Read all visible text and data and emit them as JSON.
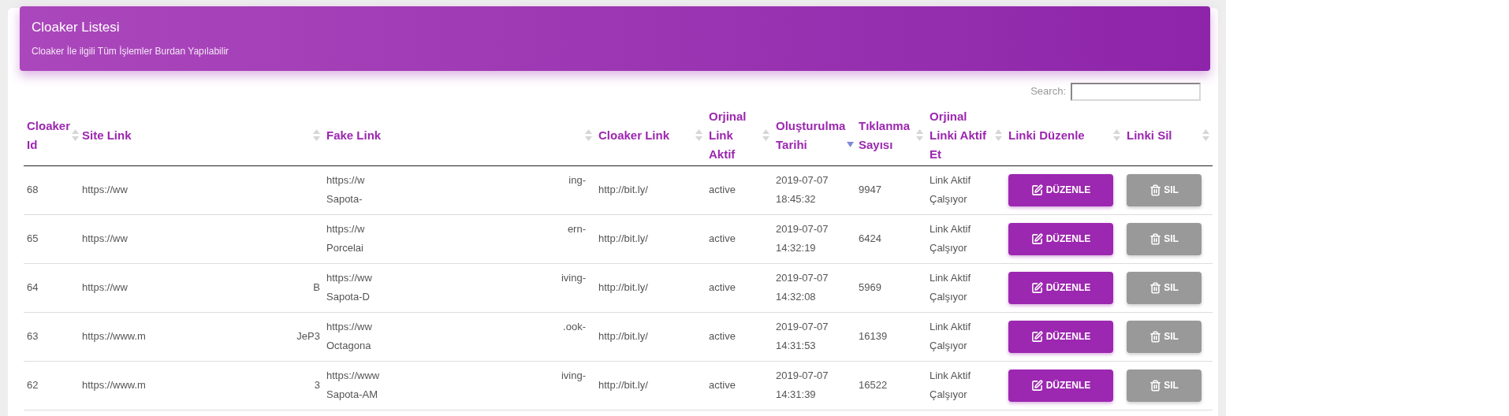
{
  "header": {
    "title": "Cloaker Listesi",
    "subtitle": "Cloaker İle ilgili Tüm İşlemler Burdan Yapılabilir"
  },
  "search": {
    "label": "Search:"
  },
  "columns": [
    {
      "label": "Cloaker Id",
      "sorted": false
    },
    {
      "label": "Site Link",
      "sorted": false
    },
    {
      "label": "Fake Link",
      "sorted": false
    },
    {
      "label": "Cloaker Link",
      "sorted": false
    },
    {
      "label": "Orjinal Link Aktif",
      "sorted": false
    },
    {
      "label": "Oluşturulma Tarihi",
      "sorted": true
    },
    {
      "label": "Tıklanma Sayısı",
      "sorted": false
    },
    {
      "label": "Orjinal Linki Aktif Et",
      "sorted": false
    },
    {
      "label": "Linki Düzenle",
      "sorted": false
    },
    {
      "label": "Linki Sil",
      "sorted": false
    }
  ],
  "rows": [
    {
      "id": "68",
      "site_link": "https://ww",
      "fake_link_start": "https://w",
      "fake_link_end": "ing-",
      "fake_link_line2": "Sapota-",
      "cloaker_link": "http://bit.ly/",
      "status": "active",
      "date": "2019-07-07",
      "time": "18:45:32",
      "clicks": "9947",
      "link_state": "Link Aktif Çalşıyor",
      "edit": "DÜZENLE",
      "delete": "SIL"
    },
    {
      "id": "65",
      "site_link": "https://ww",
      "fake_link_start": "https://w",
      "fake_link_end": "ern-",
      "fake_link_line2": "Porcelai",
      "cloaker_link": "http://bit.ly/",
      "status": "active",
      "date": "2019-07-07",
      "time": "14:32:19",
      "clicks": "6424",
      "link_state": "Link Aktif Çalşıyor",
      "edit": "DÜZENLE",
      "delete": "SIL"
    },
    {
      "id": "64",
      "site_link": "https://ww",
      "site_link_end": "B",
      "fake_link_start": "https://ww",
      "fake_link_end": "iving-",
      "fake_link_line2": "Sapota-D",
      "cloaker_link": "http://bit.ly/",
      "status": "active",
      "date": "2019-07-07",
      "time": "14:32:08",
      "clicks": "5969",
      "link_state": "Link Aktif Çalşıyor",
      "edit": "DÜZENLE",
      "delete": "SIL"
    },
    {
      "id": "63",
      "site_link": "https://www.m",
      "site_link_end": "JeP3",
      "fake_link_start": "https://ww",
      "fake_link_end": ".ook-",
      "fake_link_line2": "Octagona",
      "cloaker_link": "http://bit.ly/",
      "status": "active",
      "date": "2019-07-07",
      "time": "14:31:53",
      "clicks": "16139",
      "link_state": "Link Aktif Çalşıyor",
      "edit": "DÜZENLE",
      "delete": "SIL"
    },
    {
      "id": "62",
      "site_link": "https://www.m",
      "site_link_end": "3",
      "fake_link_start": "https://www",
      "fake_link_end": "iving-",
      "fake_link_line2": "Sapota-AM",
      "cloaker_link": "http://bit.ly/",
      "status": "active",
      "date": "2019-07-07",
      "time": "14:31:39",
      "clicks": "16522",
      "link_state": "Link Aktif Çalşıyor",
      "edit": "DÜZENLE",
      "delete": "SIL"
    }
  ]
}
